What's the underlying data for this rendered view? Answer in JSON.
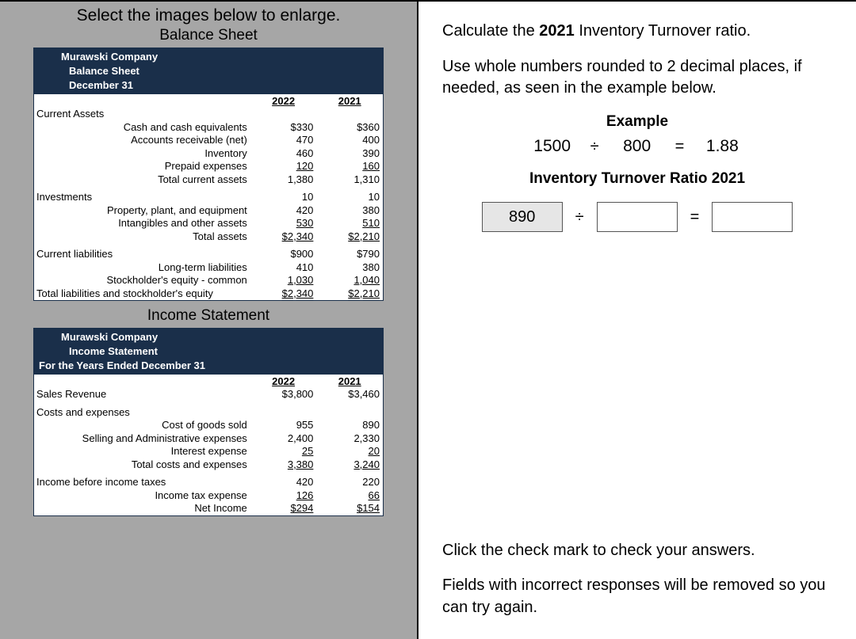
{
  "left": {
    "instruction": "Select the images below to enlarge.",
    "balance_title": "Balance Sheet",
    "income_title": "Income Statement",
    "company": "Murawski Company",
    "bs_header2": "Balance Sheet",
    "bs_header3": "December 31",
    "is_header2": "Income Statement",
    "is_header3": "For the Years Ended December 31",
    "col_2022": "2022",
    "col_2021": "2021",
    "bs": {
      "current_assets": "Current Assets",
      "cash": "Cash and cash equivalents",
      "cash_2022": "$330",
      "cash_2021": "$360",
      "ar": "Accounts receivable (net)",
      "ar_2022": "470",
      "ar_2021": "400",
      "inv": "Inventory",
      "inv_2022": "460",
      "inv_2021": "390",
      "prepaid": "Prepaid expenses",
      "prepaid_2022": "120",
      "prepaid_2021": "160",
      "tca": "Total current assets",
      "tca_2022": "1,380",
      "tca_2021": "1,310",
      "investments": "Investments",
      "investments_2022": "10",
      "investments_2021": "10",
      "ppe": "Property, plant, and equipment",
      "ppe_2022": "420",
      "ppe_2021": "380",
      "intang": "Intangibles and other assets",
      "intang_2022": "530",
      "intang_2021": "510",
      "ta": "Total assets",
      "ta_2022": "$2,340",
      "ta_2021": "$2,210",
      "cl": "Current liabilities",
      "cl_2022": "$900",
      "cl_2021": "$790",
      "ltl": "Long-term liabilities",
      "ltl_2022": "410",
      "ltl_2021": "380",
      "se": "Stockholder's equity - common",
      "se_2022": "1,030",
      "se_2021": "1,040",
      "tlse": "Total liabilities and stockholder's equity",
      "tlse_2022": "$2,340",
      "tlse_2021": "$2,210"
    },
    "is": {
      "sales": "Sales Revenue",
      "sales_2022": "$3,800",
      "sales_2021": "$3,460",
      "costs_header": "Costs and expenses",
      "cogs": "Cost of goods sold",
      "cogs_2022": "955",
      "cogs_2021": "890",
      "sa": "Selling and Administrative expenses",
      "sa_2022": "2,400",
      "sa_2021": "2,330",
      "int": "Interest expense",
      "int_2022": "25",
      "int_2021": "20",
      "tce": "Total costs and expenses",
      "tce_2022": "3,380",
      "tce_2021": "3,240",
      "ibt": "Income before income taxes",
      "ibt_2022": "420",
      "ibt_2021": "220",
      "ite": "Income tax expense",
      "ite_2022": "126",
      "ite_2021": "66",
      "ni": "Net Income",
      "ni_2022": "$294",
      "ni_2021": "$154"
    }
  },
  "right": {
    "q_pre": "Calculate the ",
    "q_bold": "2021",
    "q_post": " Inventory Turnover ratio.",
    "q_hint": "Use whole numbers rounded to 2 decimal places, if needed, as seen in the example below.",
    "example_label": "Example",
    "ex_a": "1500",
    "ex_op1": "÷",
    "ex_b": "800",
    "ex_op2": "=",
    "ex_c": "1.88",
    "ratio_title": "Inventory Turnover Ratio 2021",
    "input_numerator": "890",
    "op_div": "÷",
    "op_eq": "=",
    "footer1": "Click the check mark to check your answers.",
    "footer2": "Fields with incorrect responses will be removed so you can try again."
  }
}
